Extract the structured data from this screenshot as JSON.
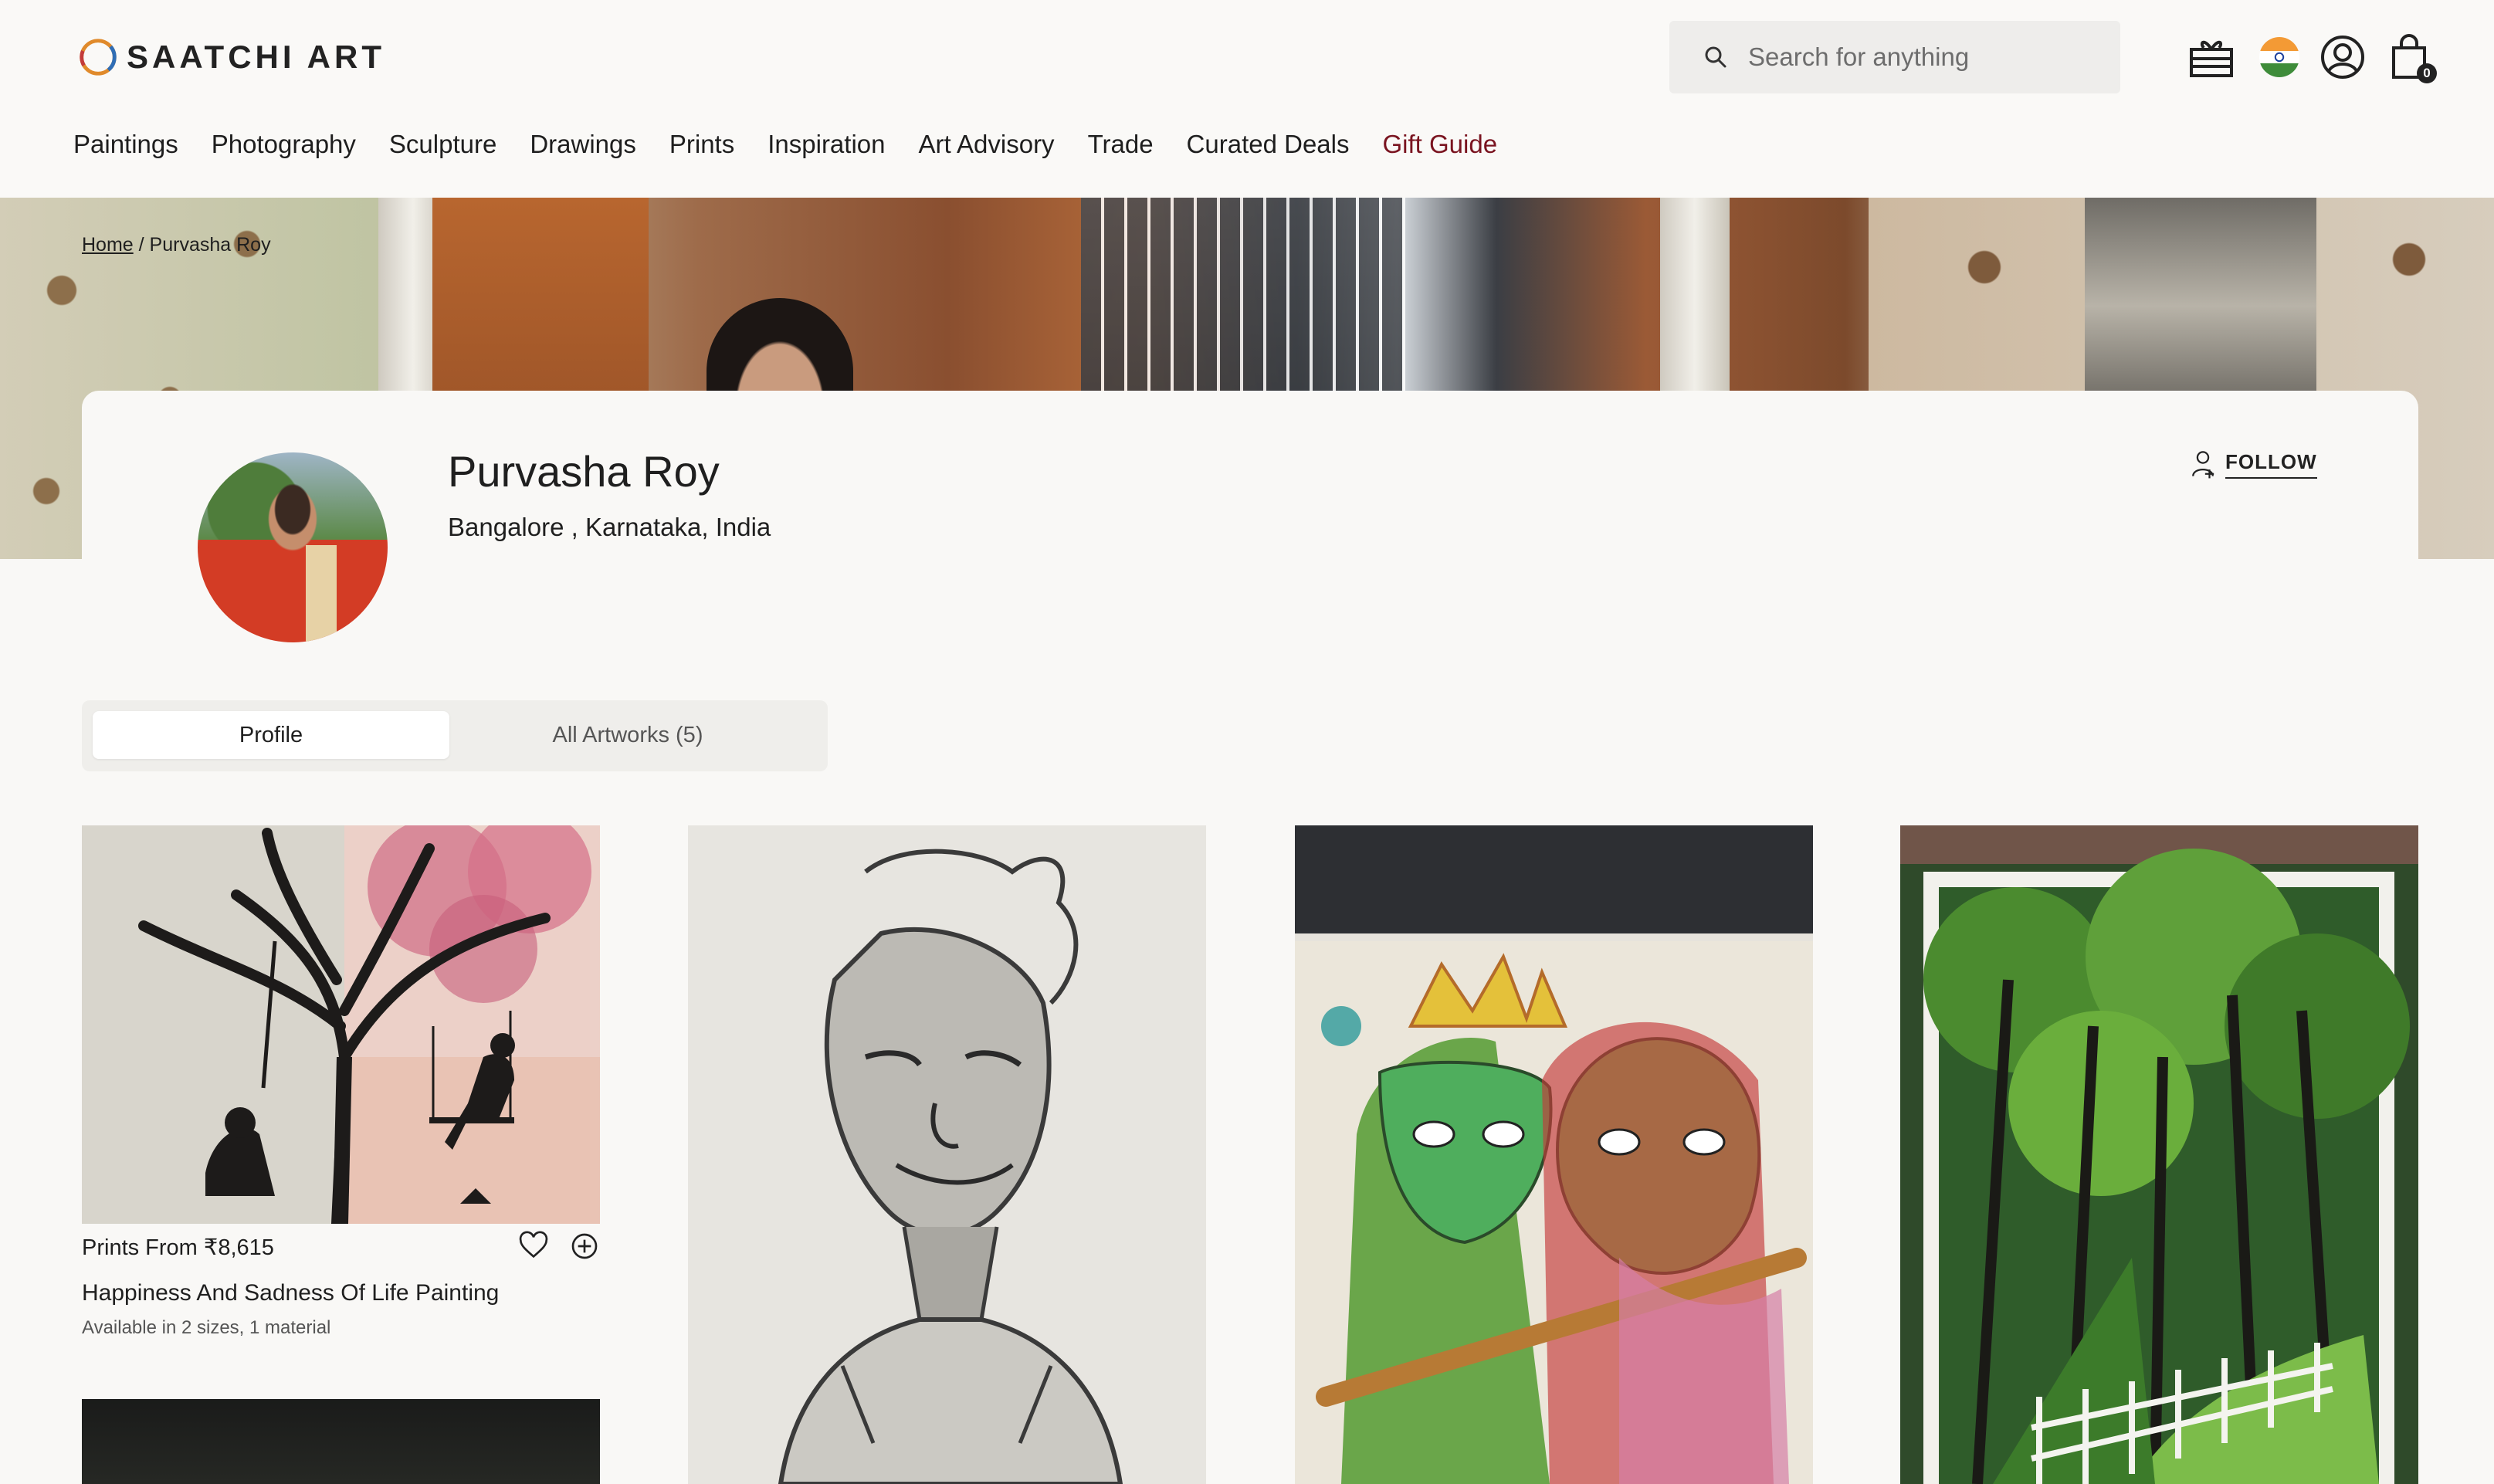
{
  "brand": {
    "name": "SAATCHI ART"
  },
  "search": {
    "placeholder": "Search for anything"
  },
  "header_icons": {
    "gift": "gift-icon",
    "region": "india-flag-icon",
    "account": "user-icon",
    "cart": "shopping-bag-icon",
    "cart_count": "0"
  },
  "nav": {
    "items": [
      "Paintings",
      "Photography",
      "Sculpture",
      "Drawings",
      "Prints",
      "Inspiration",
      "Art Advisory",
      "Trade",
      "Curated Deals",
      "Gift Guide"
    ],
    "highlight_color": "#7a1420"
  },
  "breadcrumb": {
    "home": "Home",
    "separator": "/",
    "current": "Purvasha Roy"
  },
  "artist": {
    "name": "Purvasha Roy",
    "location": "Bangalore , Karnataka, India",
    "follow_label": "FOLLOW"
  },
  "tabs": [
    {
      "label": "Profile",
      "active": true
    },
    {
      "label": "All Artworks (5)",
      "active": false
    }
  ],
  "artworks": [
    {
      "price": "Prints From ₹8,615",
      "title": "Happiness And Sadness Of Life Painting",
      "subtitle": "Available in 2 sizes, 1 material"
    }
  ]
}
